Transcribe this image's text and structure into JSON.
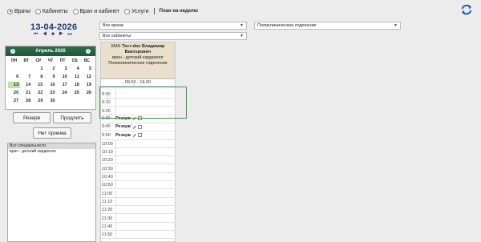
{
  "header": {
    "radios": [
      {
        "label": "Врачи",
        "checked": true
      },
      {
        "label": "Кабинеты",
        "checked": false
      },
      {
        "label": "Врач и кабинет",
        "checked": false
      },
      {
        "label": "Услуги",
        "checked": false
      }
    ],
    "plan_link": "План на неделю",
    "refresh_icon": "refresh-icon"
  },
  "date": {
    "title": "13-04-2026",
    "nav_arrows": "⏮ ◀ ■ ▶ ⏭"
  },
  "filters": {
    "doctors": "Все врачи",
    "cabinets": "Все кабинеты",
    "department": "Поликлиническое отделение"
  },
  "calendar": {
    "month": "Апрель 2026",
    "weekdays": [
      "ПН",
      "ВТ",
      "СР",
      "ЧТ",
      "ПТ",
      "СБ",
      "ВС"
    ],
    "days": [
      "",
      "",
      "1",
      "2",
      "3",
      "4",
      "5",
      "6",
      "7",
      "8",
      "9",
      "10",
      "11",
      "12",
      "13",
      "14",
      "15",
      "16",
      "17",
      "18",
      "19",
      "20",
      "21",
      "22",
      "23",
      "24",
      "25",
      "26",
      "27",
      "28",
      "29",
      "30",
      "",
      "",
      ""
    ],
    "today": "13",
    "today_color": "#b6e6a2",
    "header_color": "#1f5a39"
  },
  "buttons": {
    "reserve": "Резерв",
    "extend": "Продлить",
    "no_reception": "Нет приема"
  },
  "specialties": [
    "Все специальности",
    "врач - детский кардиолог"
  ],
  "doctor": {
    "prefix": "КМН",
    "name": "Тест-doc Владимир Викторович",
    "role": "врач - детский кардиолог",
    "department": "Поликлиническое отделение"
  },
  "schedule": {
    "hours": "09:00 - 16:00",
    "slots": [
      {
        "time": "9:00",
        "reserve": ""
      },
      {
        "time": "9:10",
        "reserve": ""
      },
      {
        "time": "9:20",
        "reserve": ""
      },
      {
        "time": "9:30",
        "reserve": "Резерв"
      },
      {
        "time": "9:40",
        "reserve": "Резерв"
      },
      {
        "time": "9:50",
        "reserve": "Резерв"
      },
      {
        "time": "10:00",
        "reserve": ""
      },
      {
        "time": "10:10",
        "reserve": ""
      },
      {
        "time": "10:20",
        "reserve": ""
      },
      {
        "time": "10:30",
        "reserve": ""
      },
      {
        "time": "10:40",
        "reserve": ""
      },
      {
        "time": "10:50",
        "reserve": ""
      },
      {
        "time": "11:00",
        "reserve": ""
      },
      {
        "time": "11:10",
        "reserve": ""
      },
      {
        "time": "11:20",
        "reserve": ""
      },
      {
        "time": "11:30",
        "reserve": ""
      },
      {
        "time": "11:40",
        "reserve": ""
      },
      {
        "time": "11:50",
        "reserve": ""
      }
    ],
    "highlight_color": "#2f9a45"
  }
}
